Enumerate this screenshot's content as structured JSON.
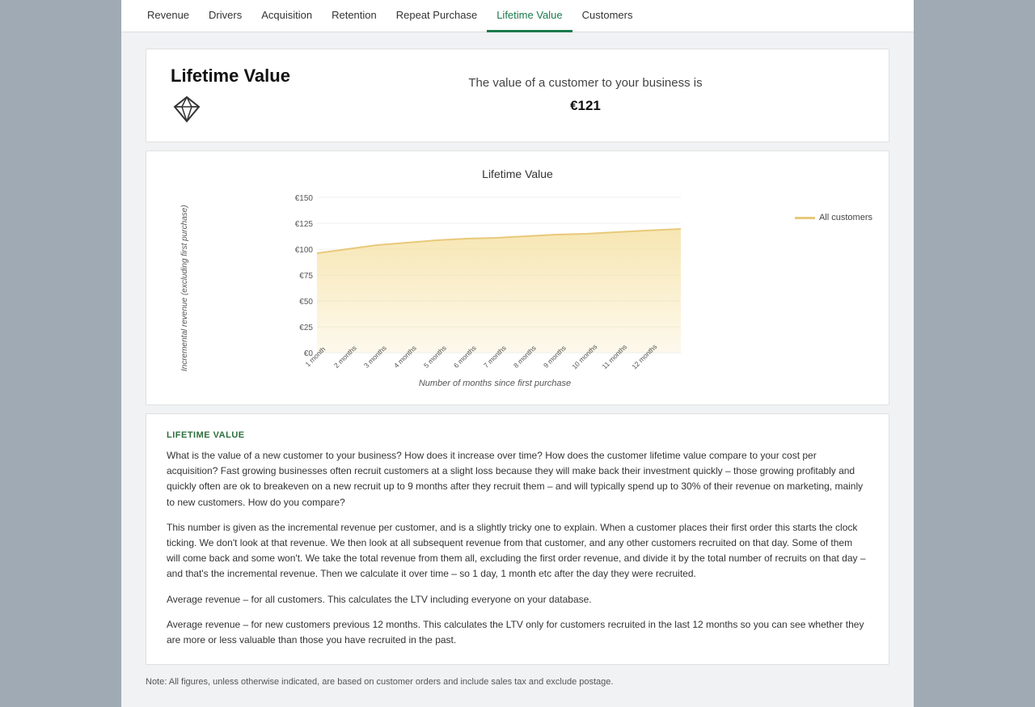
{
  "nav": {
    "items": [
      {
        "label": "Revenue",
        "active": false
      },
      {
        "label": "Drivers",
        "active": false
      },
      {
        "label": "Acquisition",
        "active": false
      },
      {
        "label": "Retention",
        "active": false
      },
      {
        "label": "Repeat Purchase",
        "active": false
      },
      {
        "label": "Lifetime Value",
        "active": true
      },
      {
        "label": "Customers",
        "active": false
      }
    ]
  },
  "header": {
    "title": "Lifetime Value",
    "subtitle": "The value of a customer to your business is",
    "value": "€121"
  },
  "chart": {
    "title": "Lifetime Value",
    "y_axis_label": "Incremental revenue (excluding first purchase)",
    "x_axis_label": "Number of months since first purchase",
    "y_ticks": [
      "€150",
      "€125",
      "€100",
      "€75",
      "€50",
      "€25",
      "€0"
    ],
    "x_ticks": [
      "1 month",
      "2 months",
      "3 months",
      "4 months",
      "5 months",
      "6 months",
      "7 months",
      "8 months",
      "9 months",
      "10 months",
      "11 months",
      "12 months"
    ],
    "legend": {
      "label": "All customers",
      "color": "#e8c97a"
    }
  },
  "info": {
    "section_title": "LIFETIME VALUE",
    "paragraphs": [
      "What is the value of a new customer to your business? How does it increase over time? How does the customer lifetime value compare to your cost per acquisition? Fast growing businesses often recruit customers at a slight loss because they will make back their investment quickly – those growing profitably and quickly often are ok to breakeven on a new recruit up to 9 months after they recruit them – and will typically spend up to 30% of their revenue on marketing, mainly to new customers. How do you compare?",
      "This number is given as the incremental revenue per customer, and is a slightly tricky one to explain. When a customer places their first order this starts the clock ticking. We don't look at that revenue. We then look at all subsequent revenue from that customer, and any other customers recruited on that day. Some of them will come back and some won't. We take the total revenue from them all, excluding the first order revenue, and divide it by the total number of recruits on that day – and that's the incremental revenue. Then we calculate it over time – so 1 day, 1 month etc after the day they were recruited.",
      "Average revenue – for all customers. This calculates the LTV including everyone on your database.",
      "Average revenue – for new customers previous 12 months. This calculates the LTV only for customers recruited in the last 12 months so you can see whether they are more or less valuable than those you have recruited in the past."
    ]
  },
  "note": "Note: All figures, unless otherwise indicated, are based on customer orders and include sales tax and exclude postage."
}
